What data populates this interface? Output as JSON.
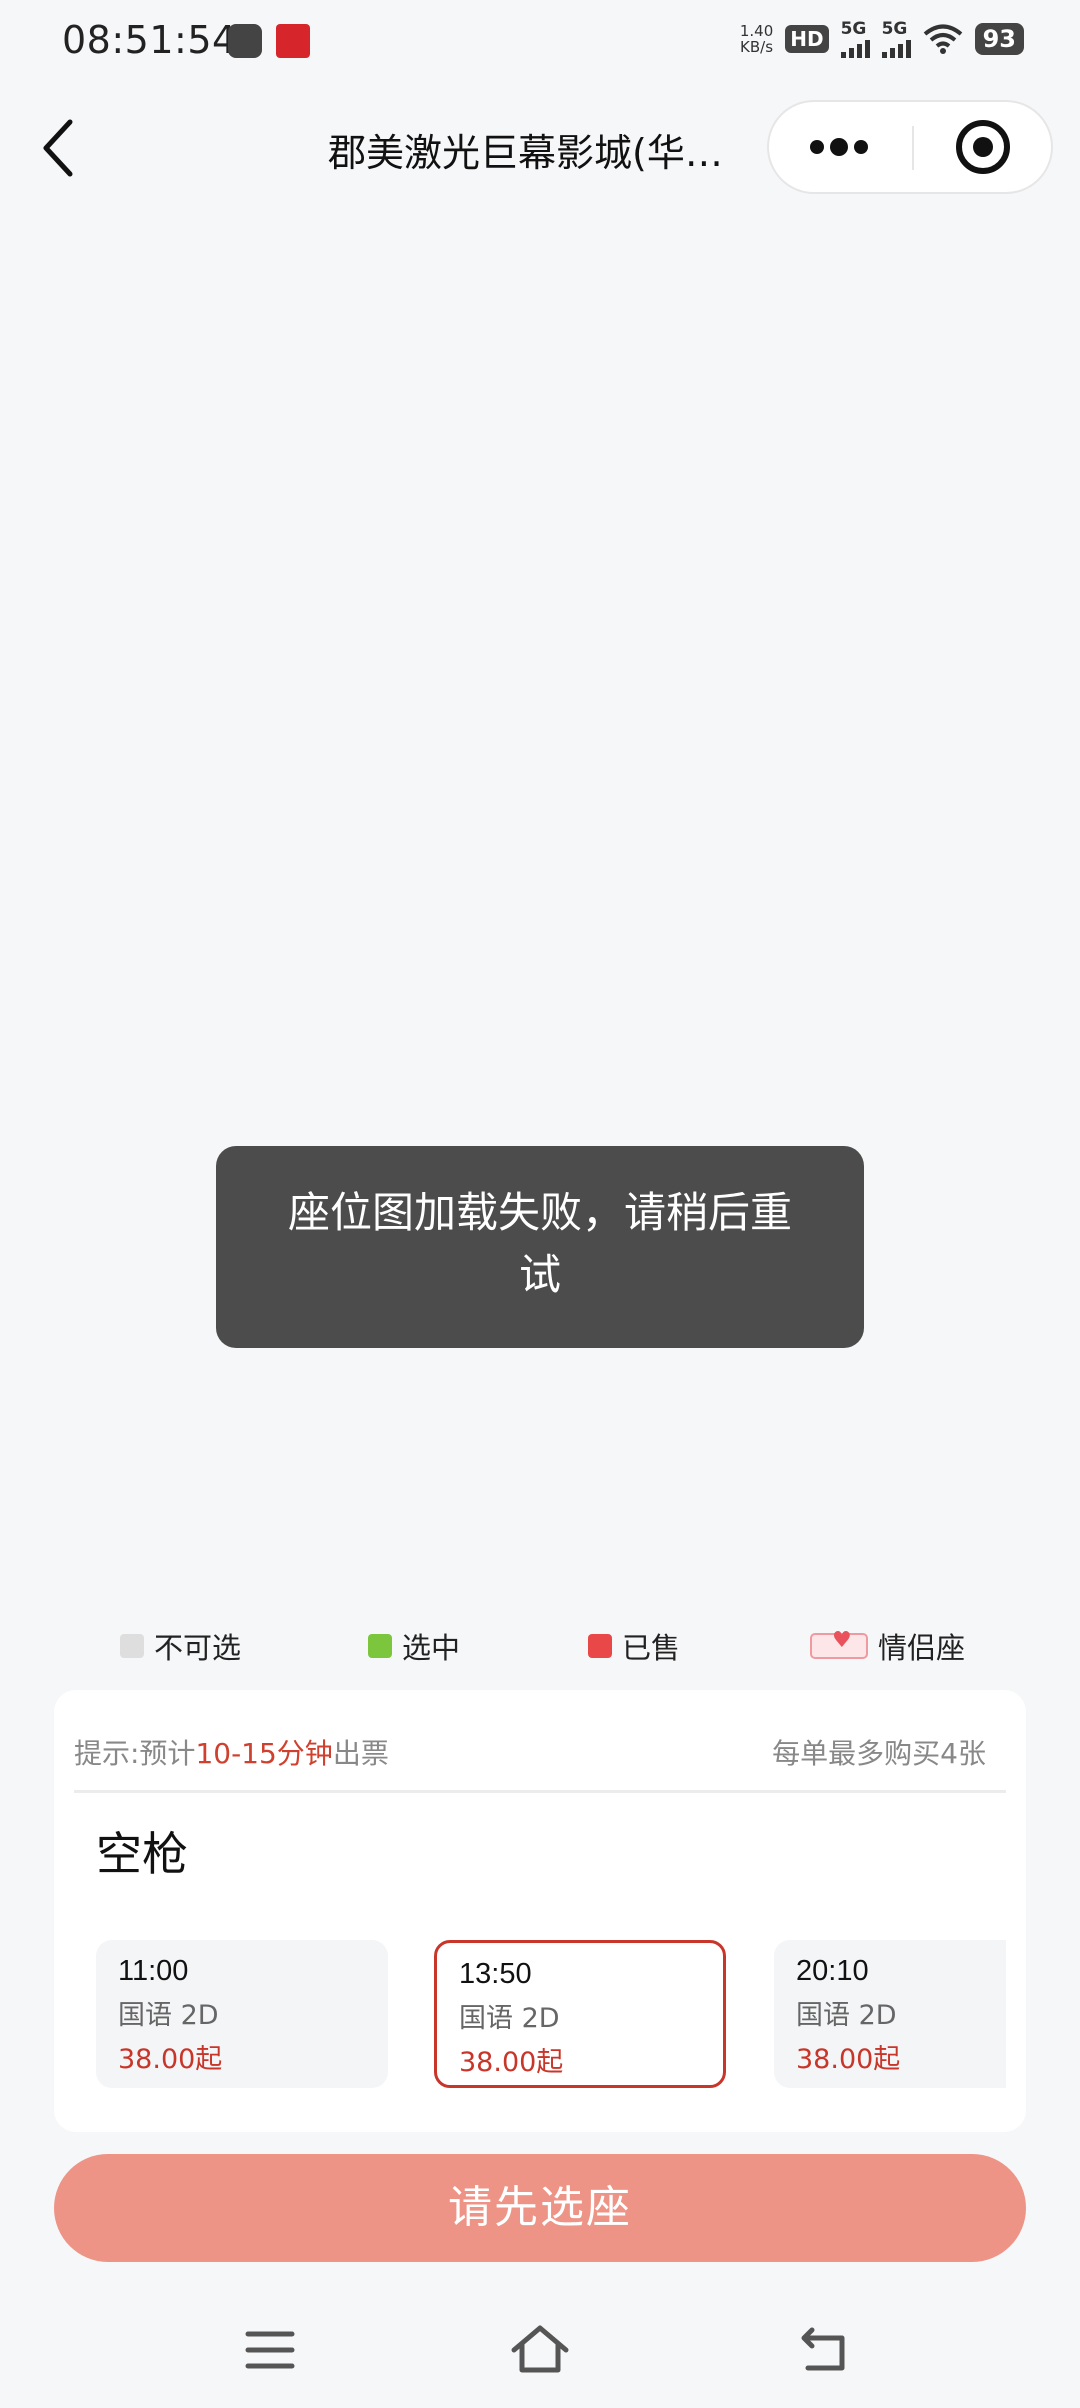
{
  "status_bar": {
    "time": "08:51:54",
    "network_speed_value": "1.40",
    "network_speed_unit": "KB/s",
    "hd_label": "HD",
    "signal_1_label": "5G",
    "signal_2_label": "5G",
    "battery": "93"
  },
  "nav": {
    "title": "郡美激光巨幕影城(华…"
  },
  "toast": {
    "message": "座位图加载失败，请稍后重试"
  },
  "legend": {
    "unavailable": "不可选",
    "selected": "选中",
    "sold": "已售",
    "couple": "情侣座"
  },
  "card": {
    "tip_prefix": "提示:预计",
    "tip_highlight": "10-15分钟",
    "tip_suffix": "出票",
    "limit": "每单最多购买4张",
    "movie_title": "空枪",
    "showtimes": [
      {
        "time": "11:00",
        "lang": "国语 2D",
        "price": "38.00起",
        "selected": false
      },
      {
        "time": "13:50",
        "lang": "国语 2D",
        "price": "38.00起",
        "selected": true
      },
      {
        "time": "20:10",
        "lang": "国语 2D",
        "price": "38.00起",
        "selected": false
      }
    ]
  },
  "action_button": {
    "label": "请先选座"
  },
  "colors": {
    "accent_red": "#c8362a",
    "button_bg": "#ee9486",
    "toast_bg": "#4c4c4c"
  },
  "icons": {
    "back": "chevron-left-icon",
    "more": "more-dots-icon",
    "close": "target-circle-icon",
    "menu": "menu-icon",
    "home": "home-icon",
    "return": "back-arrow-icon"
  }
}
